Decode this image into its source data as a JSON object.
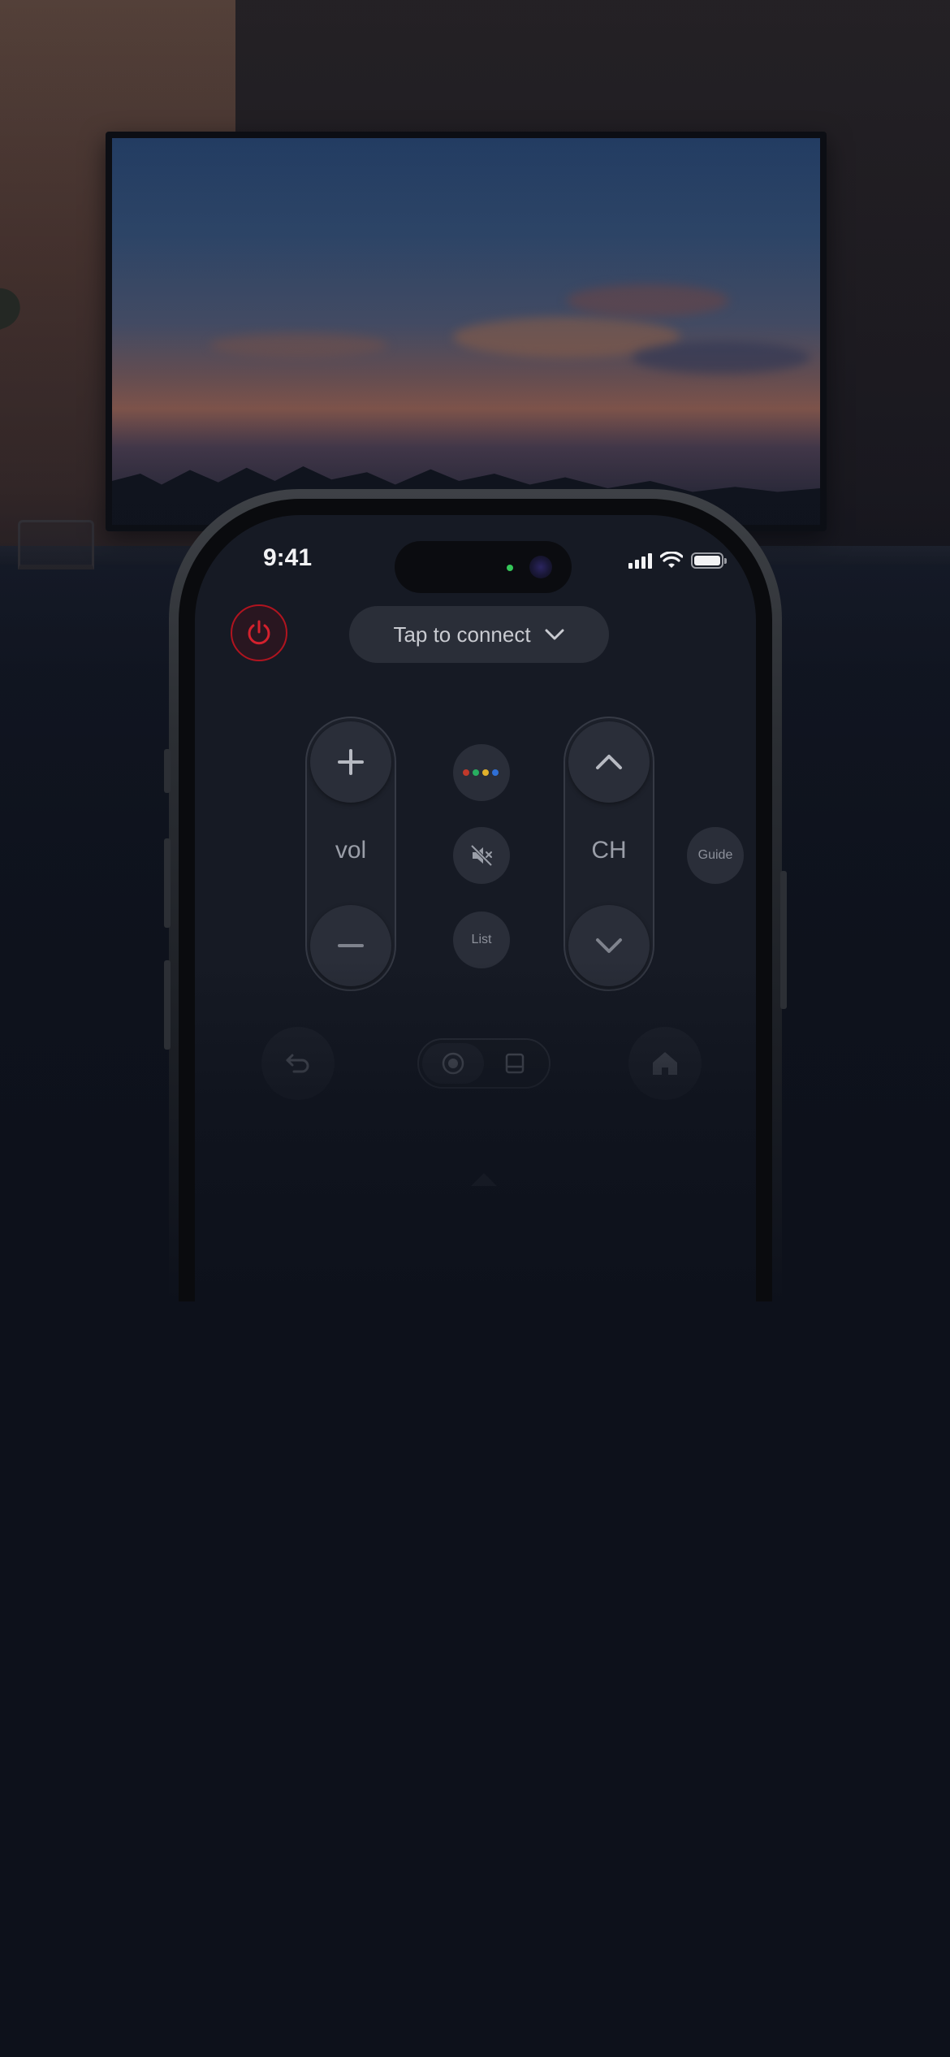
{
  "status_bar": {
    "time": "9:41",
    "signal_icon": "cellular-signal-icon",
    "wifi_icon": "wifi-icon",
    "battery_icon": "battery-icon"
  },
  "remote": {
    "power_icon": "power-icon",
    "connect_label": "Tap to connect",
    "connect_chevron_icon": "chevron-down-icon",
    "volume": {
      "label": "vol",
      "up_icon": "plus-icon",
      "down_icon": "minus-icon"
    },
    "channel": {
      "label": "CH",
      "up_icon": "chevron-up-icon",
      "down_icon": "chevron-down-icon"
    },
    "assistant_icon": "google-assistant-icon",
    "assistant_dot_colors": [
      "#c0392b",
      "#27ae60",
      "#e1b12c",
      "#2f6fd6"
    ],
    "mute_icon": "mute-icon",
    "list_label": "List",
    "guide_label": "Guide",
    "back_icon": "back-arrow-icon",
    "home_icon": "home-icon",
    "mode_toggle": {
      "dpad_icon": "dpad-icon",
      "touchpad_icon": "touchpad-icon",
      "selected": "dpad"
    },
    "expand_icon": "caret-up-icon"
  },
  "colors": {
    "power_accent": "#b0141f",
    "background": "#0d111b"
  }
}
